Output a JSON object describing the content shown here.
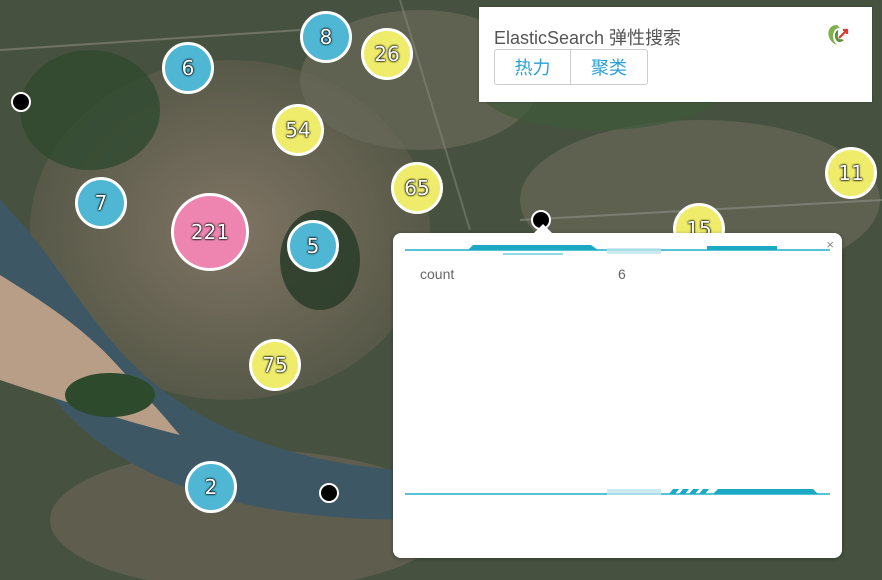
{
  "map": {
    "clusters": [
      {
        "count": "6",
        "color": "blue"
      },
      {
        "count": "8",
        "color": "blue"
      },
      {
        "count": "26",
        "color": "yellow"
      },
      {
        "count": "54",
        "color": "yellow"
      },
      {
        "count": "7",
        "color": "blue"
      },
      {
        "count": "221",
        "color": "pink"
      },
      {
        "count": "5",
        "color": "blue"
      },
      {
        "count": "65",
        "color": "yellow"
      },
      {
        "count": "15",
        "color": "yellow"
      },
      {
        "count": "11",
        "color": "yellow"
      },
      {
        "count": "75",
        "color": "yellow"
      },
      {
        "count": "2",
        "color": "blue"
      }
    ],
    "colors": {
      "blue": "#4fb7d4",
      "yellow": "#eeec6a",
      "pink": "#ee85b0"
    }
  },
  "panel": {
    "title": "ElasticSearch 弹性搜索",
    "buttons": [
      "热力",
      "聚类"
    ],
    "logo_icon": "app-logo-icon"
  },
  "popup": {
    "close": "×",
    "rows": [
      {
        "key": "count",
        "value": "6"
      }
    ]
  }
}
